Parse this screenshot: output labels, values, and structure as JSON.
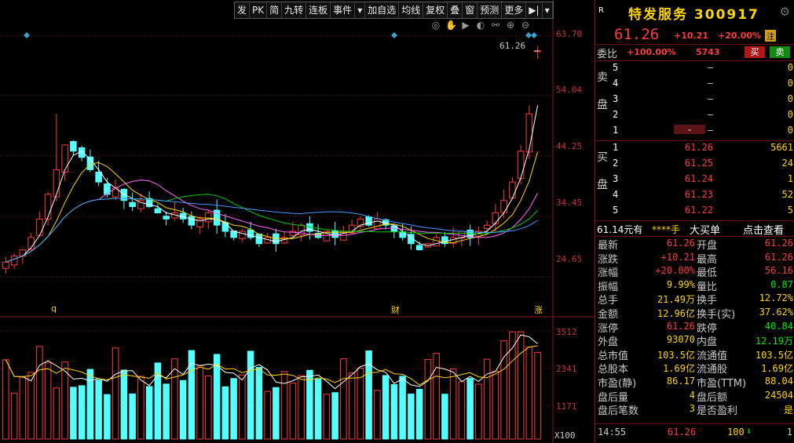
{
  "toolbar": [
    "发",
    "PK",
    "简",
    "九转",
    "连板",
    "事件",
    "▾",
    "加自选",
    "均线",
    "复权",
    "叠",
    "窗",
    "预测",
    "更多",
    "▶|",
    "▾"
  ],
  "view_tools": [
    "◎",
    "✋",
    "▶",
    "◐",
    "⚯",
    "⊕",
    "⊖"
  ],
  "price_axis": {
    "labels": [
      "63.70",
      "54.04",
      "44.25",
      "34.45",
      "24.65"
    ],
    "values": [
      63.7,
      54.04,
      44.25,
      34.45,
      24.65
    ]
  },
  "volume_axis": {
    "labels": [
      "3512",
      "2341",
      "1171"
    ],
    "unit": "X100"
  },
  "current_price_label": "61.26",
  "markers": {
    "q": "q",
    "cai": "财",
    "zhang": "涨"
  },
  "colors": {
    "up": "#ff3b3b",
    "down": "#54ffff",
    "ma5": "#ffffff",
    "ma10": "#ffd400",
    "ma20": "#ff66ff",
    "ma30": "#00cc00",
    "ma60": "#4499ff",
    "grid": "#8a1a1a"
  },
  "chart_data": {
    "type": "candlestick",
    "price_range": [
      24.65,
      63.7
    ],
    "volume_range": [
      0,
      3512
    ],
    "close_series_approx": [
      27,
      28,
      29,
      31,
      34,
      38,
      42,
      46,
      45,
      44,
      42,
      40,
      38,
      39,
      37,
      36,
      37,
      36,
      35,
      34,
      35,
      34,
      33,
      34,
      35,
      33,
      32,
      31,
      32,
      31,
      30,
      31,
      30,
      31,
      32,
      33,
      32,
      31,
      32,
      31,
      32,
      33,
      34,
      33,
      34,
      33,
      32,
      31,
      30,
      29,
      30,
      31,
      30,
      31,
      32,
      31,
      32,
      33,
      35,
      37,
      40,
      45,
      51.05,
      61.26
    ]
  },
  "quote": {
    "code_prefix": "R",
    "name_code": "特发服务 300917",
    "price": "61.26",
    "change": "+10.21",
    "change_pct": "+20.00%",
    "badge": "注",
    "weibi_label": "委比",
    "weibi_value": "+100.00%",
    "weicha": "5743",
    "buy_btn": "买",
    "sell_btn": "卖",
    "sell_label": "卖\n盘",
    "buy_label": "买\n盘",
    "sell_book": [
      {
        "lv": "5",
        "price": "–",
        "vol": "0"
      },
      {
        "lv": "4",
        "price": "–",
        "vol": "0"
      },
      {
        "lv": "3",
        "price": "–",
        "vol": "0"
      },
      {
        "lv": "2",
        "price": "–",
        "vol": "0"
      },
      {
        "lv": "1",
        "price": "–",
        "vol": "0"
      }
    ],
    "buy_book": [
      {
        "lv": "1",
        "price": "61.26",
        "vol": "5661"
      },
      {
        "lv": "2",
        "price": "61.25",
        "vol": "24"
      },
      {
        "lv": "3",
        "price": "61.24",
        "vol": "1"
      },
      {
        "lv": "4",
        "price": "61.23",
        "vol": "52"
      },
      {
        "lv": "5",
        "price": "61.22",
        "vol": "5"
      }
    ],
    "info_left": "61.14元有",
    "info_mid": "****手",
    "info_big": "大买单",
    "info_link": "点击查看",
    "stats": [
      [
        "最新",
        "61.26",
        "开盘",
        "61.26"
      ],
      [
        "涨跌",
        "+10.21",
        "最高",
        "61.26"
      ],
      [
        "涨幅",
        "+20.00%",
        "最低",
        "56.16"
      ],
      [
        "振幅",
        "9.99%",
        "量比",
        "0.87"
      ],
      [
        "总手",
        "21.49万",
        "换手",
        "12.72%"
      ],
      [
        "金额",
        "12.96亿",
        "换手(实)",
        "37.62%"
      ],
      [
        "涨停",
        "61.26",
        "跌停",
        "40.84"
      ],
      [
        "外盘",
        "93070",
        "内盘",
        "12.19万"
      ],
      [
        "总市值",
        "103.5亿",
        "流通值",
        "103.5亿"
      ],
      [
        "总股本",
        "1.69亿",
        "流通股",
        "1.69亿"
      ],
      [
        "市盈(静)",
        "86.17",
        "市盈(TTM)",
        "88.04"
      ],
      [
        "盘后量",
        "4",
        "盘后额",
        "24504"
      ],
      [
        "盘后笔数",
        "3",
        "是否盈利",
        "是"
      ]
    ],
    "tick": {
      "time": "14:55",
      "price": "61.26",
      "vol": "100",
      "arrow": "⬇",
      "count": "1"
    }
  }
}
